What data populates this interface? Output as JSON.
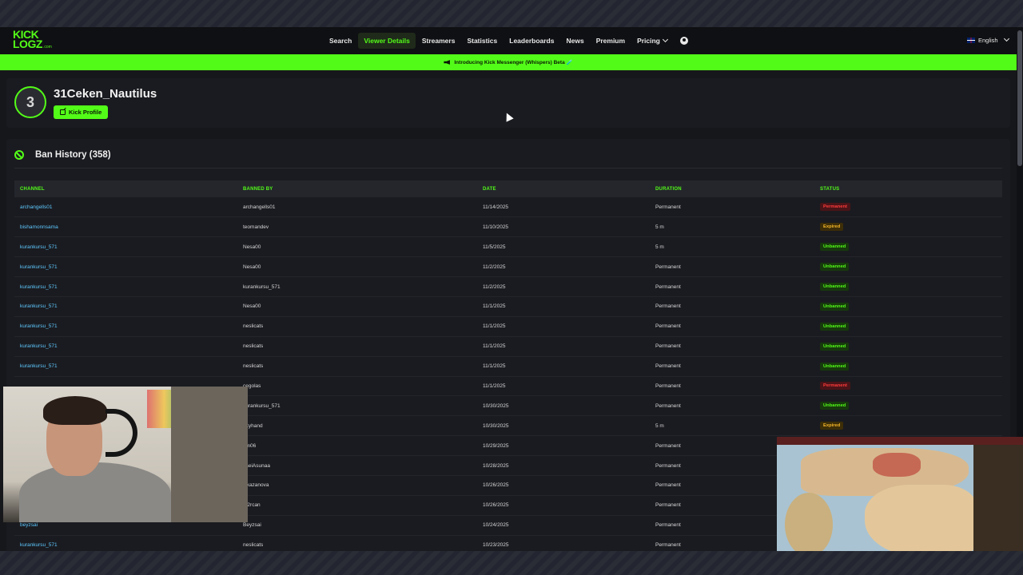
{
  "navbar": {
    "logo_line1": "KICK",
    "logo_line2": "LOGZ",
    "logo_suffix": ".com",
    "items": [
      {
        "label": "Search"
      },
      {
        "label": "Viewer Details",
        "active": true
      },
      {
        "label": "Streamers"
      },
      {
        "label": "Statistics"
      },
      {
        "label": "Leaderboards"
      },
      {
        "label": "News"
      },
      {
        "label": "Premium"
      },
      {
        "label": "Pricing"
      }
    ],
    "language": "English",
    "icons": [
      "user-icon",
      "chevron-down-icon",
      "flag-icon"
    ]
  },
  "banner": {
    "text": "Introducing Kick Messenger (Whispers) Beta 🧪"
  },
  "profile": {
    "avatar_letter": "3",
    "username": "31Ceken_Nautilus",
    "kick_profile_label": "Kick Profile"
  },
  "ban_history": {
    "title": "Ban History (358)",
    "columns": [
      "CHANNEL",
      "BANNED BY",
      "DATE",
      "DURATION",
      "STATUS"
    ],
    "rows": [
      {
        "channel": "archangells01",
        "banned_by": "archangells01",
        "date": "11/14/2025",
        "duration": "Permanent",
        "status": "Permanent"
      },
      {
        "channel": "bishamonnsama",
        "banned_by": "teomandev",
        "date": "11/10/2025",
        "duration": "5 m",
        "status": "Expired"
      },
      {
        "channel": "kurankursu_571",
        "banned_by": "Nesa00",
        "date": "11/5/2025",
        "duration": "5 m",
        "status": "Unbanned"
      },
      {
        "channel": "kurankursu_571",
        "banned_by": "Nesa00",
        "date": "11/2/2025",
        "duration": "Permanent",
        "status": "Unbanned"
      },
      {
        "channel": "kurankursu_571",
        "banned_by": "kurankursu_571",
        "date": "11/2/2025",
        "duration": "Permanent",
        "status": "Unbanned"
      },
      {
        "channel": "kurankursu_571",
        "banned_by": "Nesa00",
        "date": "11/1/2025",
        "duration": "Permanent",
        "status": "Unbanned"
      },
      {
        "channel": "kurankursu_571",
        "banned_by": "neslicats",
        "date": "11/1/2025",
        "duration": "Permanent",
        "status": "Unbanned"
      },
      {
        "channel": "kurankursu_571",
        "banned_by": "neslicats",
        "date": "11/1/2025",
        "duration": "Permanent",
        "status": "Unbanned"
      },
      {
        "channel": "kurankursu_571",
        "banned_by": "neslicats",
        "date": "11/1/2025",
        "duration": "Permanent",
        "status": "Unbanned"
      },
      {
        "channel": "",
        "banned_by": "cegolas",
        "date": "11/1/2025",
        "duration": "Permanent",
        "status": "Permanent"
      },
      {
        "channel": "",
        "banned_by": "kurankursu_571",
        "date": "10/30/2025",
        "duration": "Permanent",
        "status": "Unbanned"
      },
      {
        "channel": "",
        "banned_by": "akyhand",
        "date": "10/30/2025",
        "duration": "5 m",
        "status": "Expired"
      },
      {
        "channel": "",
        "banned_by": "em06",
        "date": "10/29/2025",
        "duration": "Permanent",
        "status": ""
      },
      {
        "channel": "",
        "banned_by": "nseiAsunaa",
        "date": "10/28/2025",
        "duration": "Permanent",
        "status": ""
      },
      {
        "channel": "",
        "banned_by": "iskazanova",
        "date": "10/26/2025",
        "duration": "Permanent",
        "status": ""
      },
      {
        "channel": "",
        "banned_by": "m2rcan",
        "date": "10/26/2025",
        "duration": "Permanent",
        "status": ""
      },
      {
        "channel": "beyzsai",
        "banned_by": "Beyzsai",
        "date": "10/24/2025",
        "duration": "Permanent",
        "status": ""
      },
      {
        "channel": "kurankursu_571",
        "banned_by": "neslicats",
        "date": "10/23/2025",
        "duration": "Permanent",
        "status": ""
      }
    ]
  },
  "colors": {
    "accent": "#53fc18",
    "link": "#5ec8ff",
    "permanent": "#ff3b3b",
    "expired": "#f5b72a",
    "background": "#16171b"
  }
}
